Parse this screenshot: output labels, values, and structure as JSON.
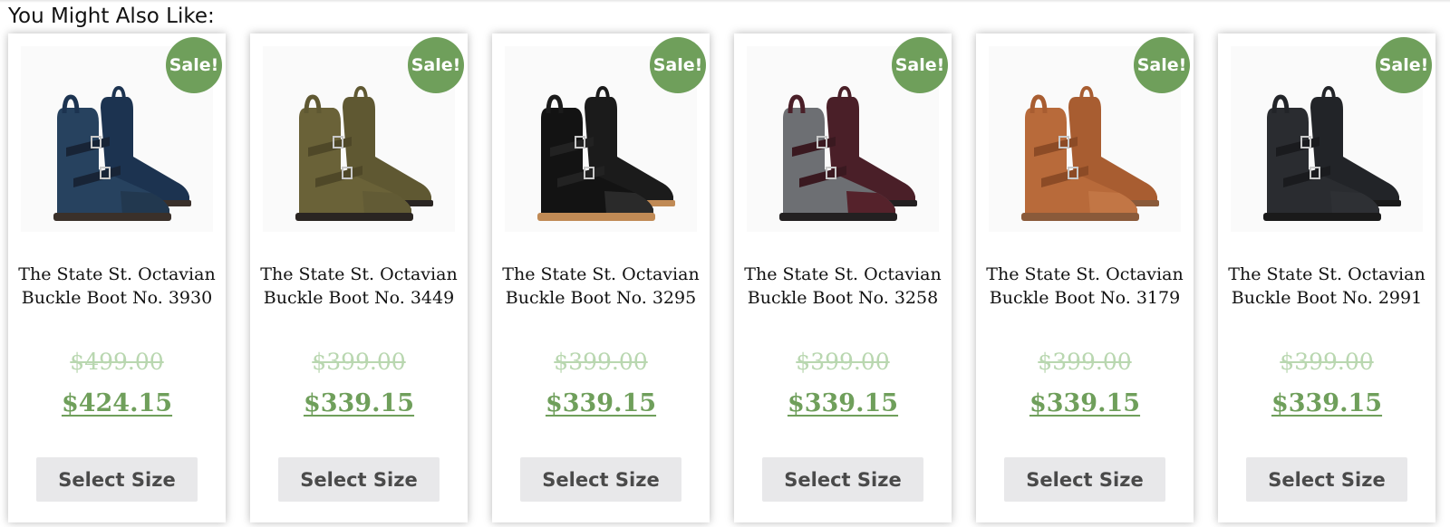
{
  "section": {
    "heading": "You Might Also Like:"
  },
  "products": [
    {
      "name": "The State St. Octavian Buckle Boot No. 3930",
      "badge": "Sale!",
      "original_price": "$499.00",
      "sale_price": "$424.15",
      "button_label": "Select Size",
      "colors": {
        "body": "#27425f",
        "shaft": "#1c3350",
        "toe": "#22384f",
        "sole": "#3a302a",
        "strap": "#182436"
      }
    },
    {
      "name": "The State St. Octavian Buckle Boot No. 3449",
      "badge": "Sale!",
      "original_price": "$399.00",
      "sale_price": "$339.15",
      "button_label": "Select Size",
      "colors": {
        "body": "#6a6238",
        "shaft": "#5f5832",
        "toe": "#625b35",
        "sole": "#2a2522",
        "strap": "#4f4828"
      }
    },
    {
      "name": "The State St. Octavian Buckle Boot No. 3295",
      "badge": "Sale!",
      "original_price": "$399.00",
      "sale_price": "$339.15",
      "button_label": "Select Size",
      "colors": {
        "body": "#131313",
        "shaft": "#1b1b1b",
        "toe": "#2a2a2a",
        "sole": "#c08a55",
        "strap": "#222222"
      }
    },
    {
      "name": "The State St. Octavian Buckle Boot No. 3258",
      "badge": "Sale!",
      "original_price": "$399.00",
      "sale_price": "$339.15",
      "button_label": "Select Size",
      "colors": {
        "body": "#6d6f73",
        "shaft": "#4a1f28",
        "toe": "#55222b",
        "sole": "#232021",
        "strap": "#3a1920"
      }
    },
    {
      "name": "The State St. Octavian Buckle Boot No. 3179",
      "badge": "Sale!",
      "original_price": "$399.00",
      "sale_price": "$339.15",
      "button_label": "Select Size",
      "colors": {
        "body": "#b86a3a",
        "shaft": "#a85d31",
        "toe": "#c27645",
        "sole": "#8a5a3a",
        "strap": "#8c4b26"
      }
    },
    {
      "name": "The State St. Octavian Buckle Boot No. 2991",
      "badge": "Sale!",
      "original_price": "$399.00",
      "sale_price": "$339.15",
      "button_label": "Select Size",
      "colors": {
        "body": "#2a2c30",
        "shaft": "#222428",
        "toe": "#2e3034",
        "sole": "#1a1a1a",
        "strap": "#1a1b1e"
      }
    }
  ],
  "theme": {
    "sale_green": "#6f9f5b",
    "original_price_green": "#b9d7b0",
    "button_bg": "#e8e8ea",
    "button_text": "#4a4a4a"
  }
}
